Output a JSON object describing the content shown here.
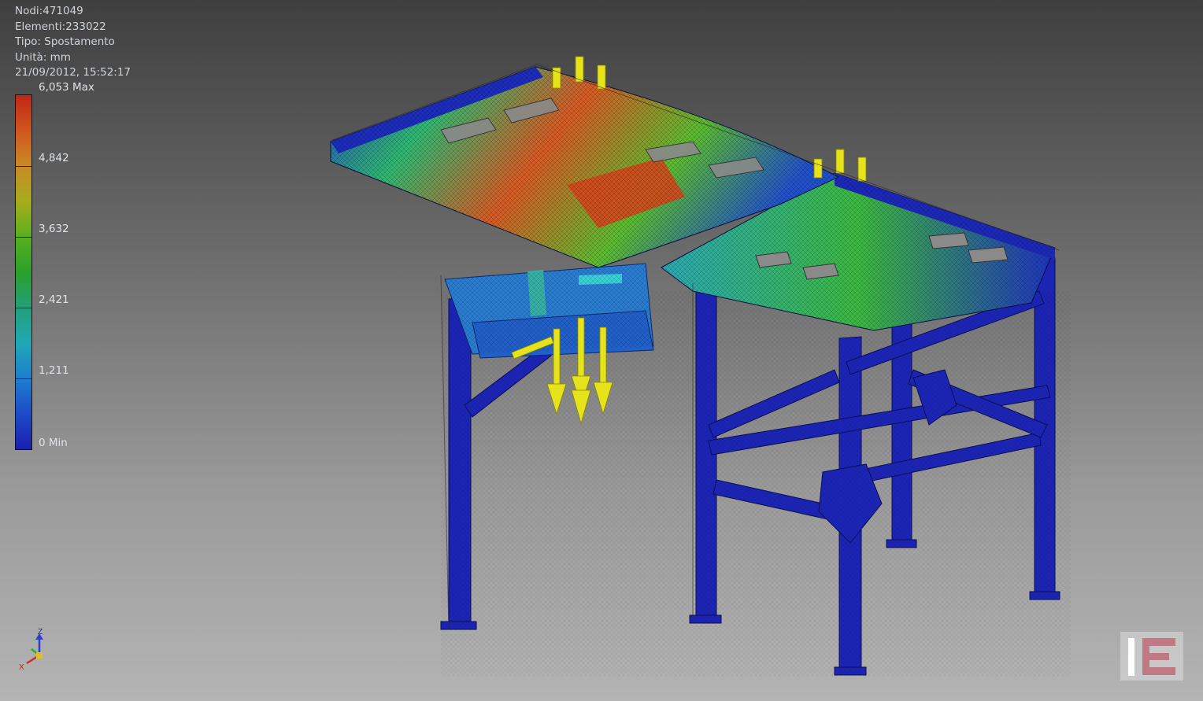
{
  "info": {
    "nodes": "Nodi:471049",
    "elements": "Elementi:233022",
    "type": "Tipo: Spostamento",
    "units": "Unità: mm",
    "datetime": "21/09/2012, 15:52:17"
  },
  "legend": {
    "max_label": "6,053 Max",
    "v2": "4,842",
    "v3": "3,632",
    "v4": "2,421",
    "v5": "1,211",
    "min_label": "0 Min",
    "colors": [
      "#c02616",
      "#c98a26",
      "#2aa02a",
      "#20a8b4",
      "#1a1fb0"
    ]
  },
  "triad": {
    "z": "Z",
    "x": "X"
  },
  "colors": {
    "low": "#1c24b4",
    "mid": "#36b84a",
    "high": "#d8461e",
    "load": "#e6e21c"
  }
}
